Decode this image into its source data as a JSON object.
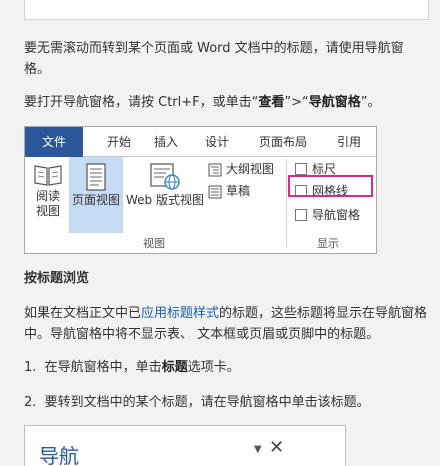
{
  "intro": {
    "p1": "要无需滚动而转到某个页面或 Word 文档中的标题，请使用导航窗格。",
    "p2_prefix": "要打开导航窗格，请按 Ctrl+F，或单击“",
    "p2_view": "查看",
    "p2_mid": "”>“",
    "p2_pane": "导航窗格",
    "p2_suffix": "”。"
  },
  "ribbon": {
    "tabs": [
      "文件",
      "开始",
      "插入",
      "设计",
      "页面布局",
      "引用"
    ],
    "buttons": {
      "read_mode_line1": "阅读",
      "read_mode_line2": "视图",
      "print_layout": "页面视图",
      "web_layout": "Web 版式视图",
      "outline": "大纲视图",
      "draft": "草稿"
    },
    "checks": [
      "标尺",
      "网格线",
      "导航窗格"
    ],
    "groups": {
      "views": "视图",
      "show": "显示"
    }
  },
  "section": {
    "heading": "按标题浏览",
    "p_prefix": "如果在文档正文中已",
    "p_link": "应用标题样式",
    "p_suffix": "的标题，这些标题将显示在导航窗格中。导航窗格中将不显示表、 文本框或页眉或页脚中的标题。",
    "step1_num": "1.",
    "step1_prefix": "在导航窗格中，单击",
    "step1_bold": "标题",
    "step1_suffix": "选项卡。",
    "step2_num": "2.",
    "step2_text": "要转到文档中的某个标题，请在导航窗格中单击该标题。"
  },
  "navpane": {
    "title": "导航",
    "dropdown": "▼",
    "close": "✕"
  }
}
